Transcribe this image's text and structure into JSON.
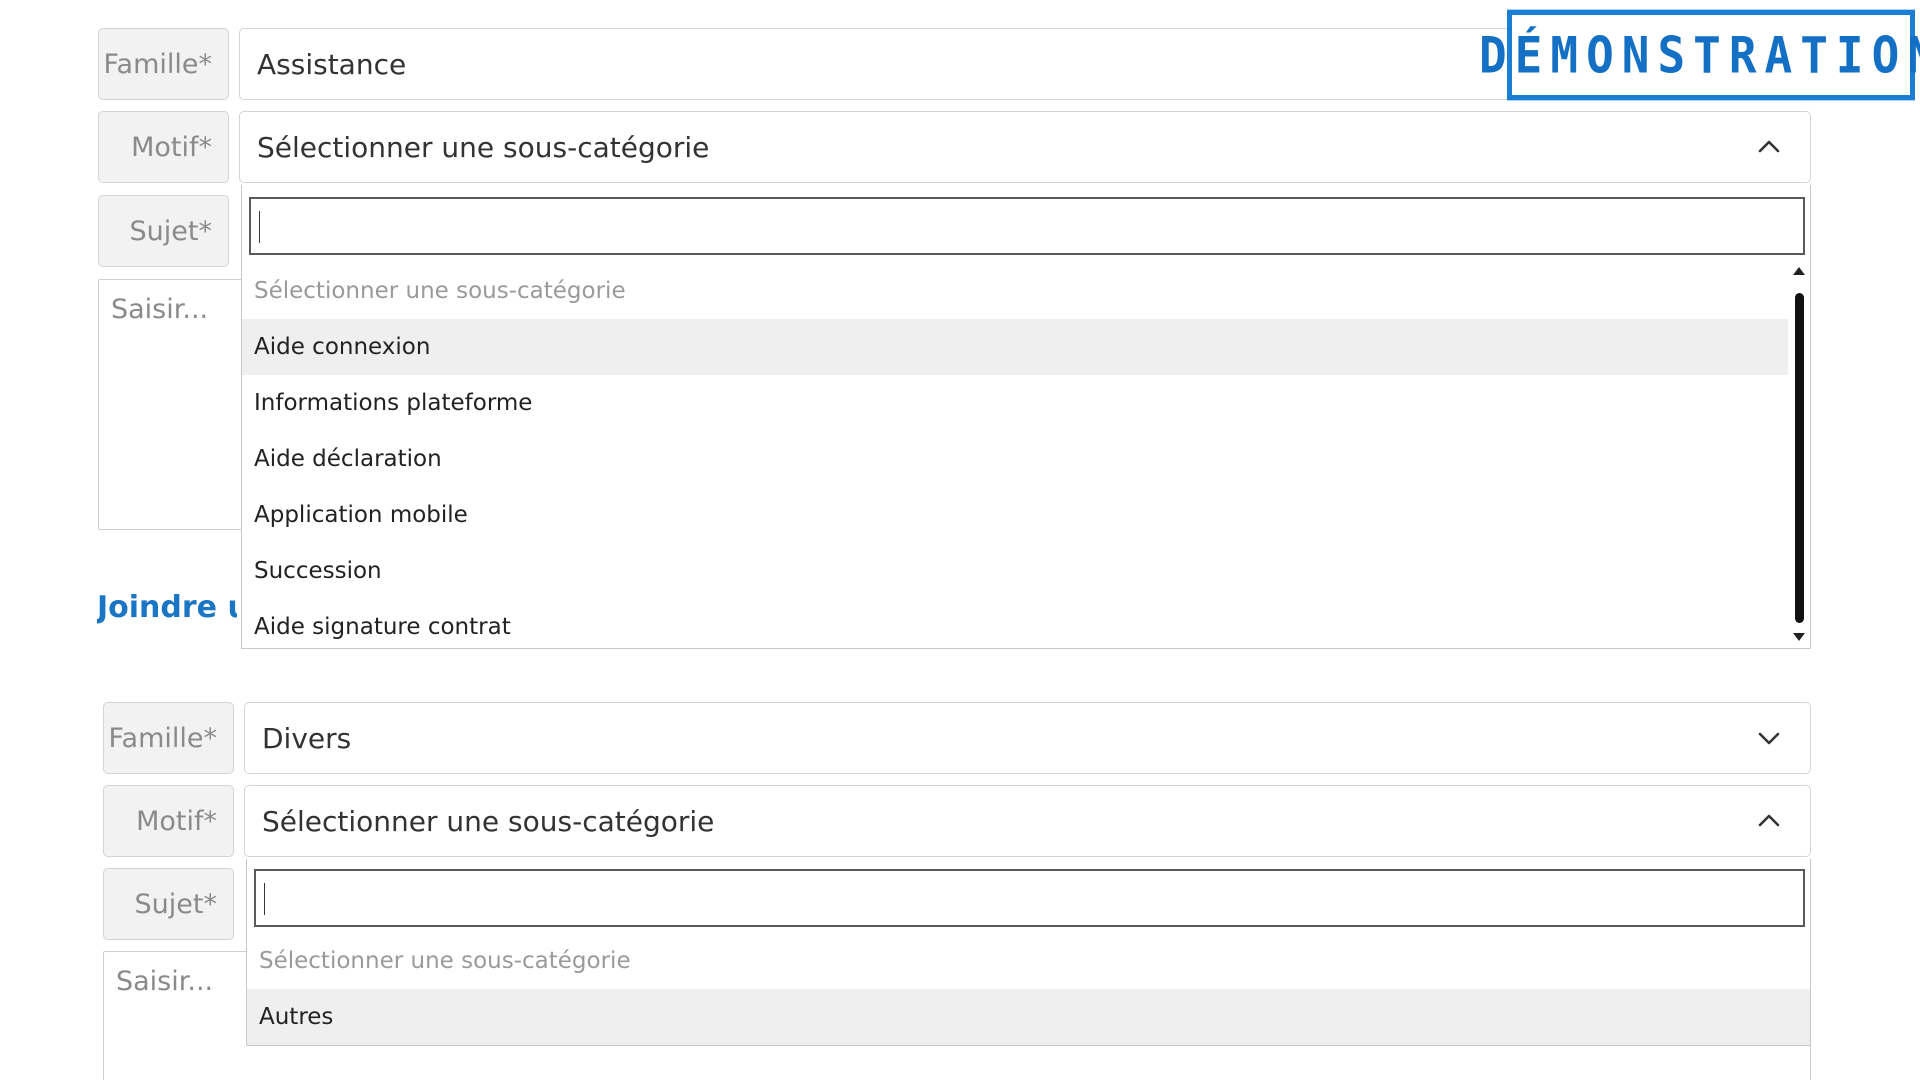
{
  "form1": {
    "famille_label": "Famille*",
    "famille_value": "Assistance",
    "motif_label": "Motif*",
    "motif_value": "Sélectionner une sous-catégorie",
    "sujet_label": "Sujet*",
    "message_placeholder": "Saisir...",
    "join_text": "Joindre u",
    "dropdown": {
      "search_value": "",
      "options": [
        {
          "label": "Sélectionner une sous-catégorie",
          "placeholder": true
        },
        {
          "label": "Aide connexion",
          "highlighted": true
        },
        {
          "label": "Informations plateforme"
        },
        {
          "label": "Aide déclaration"
        },
        {
          "label": "Application mobile"
        },
        {
          "label": "Succession"
        },
        {
          "label": "Aide signature contrat"
        }
      ]
    }
  },
  "form2": {
    "famille_label": "Famille*",
    "famille_value": "Divers",
    "motif_label": "Motif*",
    "motif_value": "Sélectionner une sous-catégorie",
    "sujet_label": "Sujet*",
    "message_placeholder": "Saisir...",
    "dropdown": {
      "search_value": "",
      "options": [
        {
          "label": "Sélectionner une sous-catégorie",
          "placeholder": true
        },
        {
          "label": "Autres",
          "highlighted": true
        }
      ]
    }
  },
  "watermark": {
    "text": "DÉMONSTRATION",
    "color": "#1a7fd4"
  },
  "icons": {
    "chevron_up": "chevron-up-icon",
    "chevron_down": "chevron-down-icon"
  }
}
